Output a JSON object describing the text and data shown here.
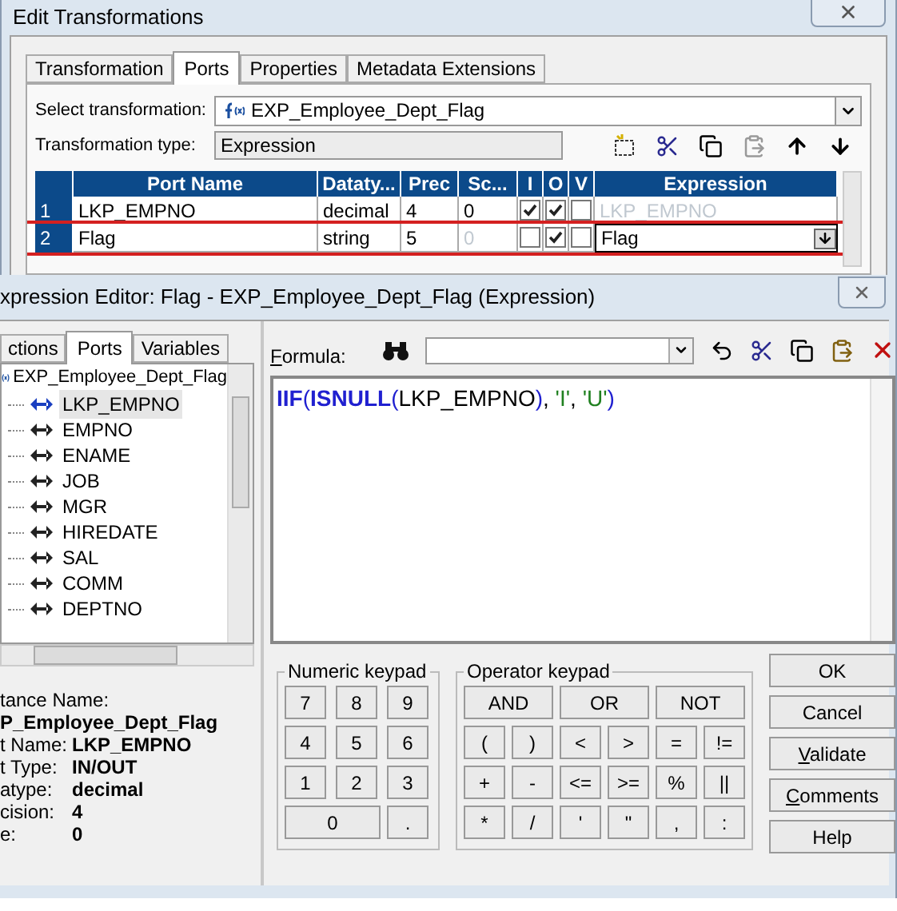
{
  "window": {
    "title": "Edit Transformations"
  },
  "tabs": [
    {
      "label": "Transformation",
      "selected": false
    },
    {
      "label": "Ports",
      "selected": true
    },
    {
      "label": "Properties",
      "selected": false
    },
    {
      "label": "Metadata Extensions",
      "selected": false
    }
  ],
  "select_transformation": {
    "label": "Select transformation:",
    "value": "EXP_Employee_Dept_Flag"
  },
  "transformation_type": {
    "label": "Transformation type:",
    "value": "Expression"
  },
  "ports_table": {
    "columns": [
      "Port Name",
      "Dataty...",
      "Prec",
      "Sc...",
      "I",
      "O",
      "V",
      "Expression"
    ],
    "rows": [
      {
        "number": "1",
        "name": "LKP_EMPNO",
        "datatype": "decimal",
        "prec": "4",
        "scale": "0",
        "scale_disabled": false,
        "input": true,
        "output": true,
        "variable": false,
        "expression": "LKP_EMPNO",
        "kind": "readonly",
        "highlighted": false
      },
      {
        "number": "2",
        "name": "Flag",
        "datatype": "string",
        "prec": "5",
        "scale": "0",
        "scale_disabled": true,
        "input": false,
        "output": true,
        "variable": false,
        "expression": "Flag",
        "kind": "editing",
        "highlighted": true
      }
    ]
  },
  "editor": {
    "title": "xpression Editor: Flag - EXP_Employee_Dept_Flag (Expression)",
    "tabs": [
      {
        "label": "ctions",
        "selected": false
      },
      {
        "label": "Ports",
        "selected": true
      },
      {
        "label": "Variables",
        "selected": false
      }
    ],
    "tree": {
      "label": "EXP_Employee_Dept_Flag",
      "children": [
        {
          "label": "LKP_EMPNO",
          "selected": true
        },
        {
          "label": "EMPNO",
          "selected": false
        },
        {
          "label": "ENAME",
          "selected": false
        },
        {
          "label": "JOB",
          "selected": false
        },
        {
          "label": "MGR",
          "selected": false
        },
        {
          "label": "HIREDATE",
          "selected": false
        },
        {
          "label": "SAL",
          "selected": false
        },
        {
          "label": "COMM",
          "selected": false
        },
        {
          "label": "DEPTNO",
          "selected": false
        }
      ]
    },
    "info": {
      "instance_label": "tance Name:",
      "instance_value": "P_Employee_Dept_Flag",
      "fields": [
        {
          "label": "t Name:",
          "value": "LKP_EMPNO"
        },
        {
          "label": "t Type:",
          "value": "IN/OUT"
        },
        {
          "label": "atype:",
          "value": "decimal"
        },
        {
          "label": "cision:",
          "value": "4"
        },
        {
          "label": "e:",
          "value": "0"
        }
      ]
    },
    "formula_label": "Formula:",
    "formula": [
      {
        "kind": "function",
        "text": "IIF"
      },
      {
        "kind": "paren",
        "text": "("
      },
      {
        "kind": "function",
        "text": "ISNULL"
      },
      {
        "kind": "paren",
        "text": "("
      },
      {
        "kind": "plain",
        "text": "LKP_EMPNO"
      },
      {
        "kind": "paren",
        "text": ")"
      },
      {
        "kind": "plain",
        "text": ", "
      },
      {
        "kind": "string",
        "text": "'I'"
      },
      {
        "kind": "plain",
        "text": ", "
      },
      {
        "kind": "string",
        "text": "'U'"
      },
      {
        "kind": "paren",
        "text": ")"
      }
    ],
    "numeric_keypad": {
      "title": "Numeric keypad",
      "keys": [
        {
          "label": "7",
          "kind": "normal"
        },
        {
          "label": "8",
          "kind": "normal"
        },
        {
          "label": "9",
          "kind": "normal"
        },
        {
          "label": "4",
          "kind": "normal"
        },
        {
          "label": "5",
          "kind": "normal"
        },
        {
          "label": "6",
          "kind": "normal"
        },
        {
          "label": "1",
          "kind": "normal"
        },
        {
          "label": "2",
          "kind": "normal"
        },
        {
          "label": "3",
          "kind": "normal"
        },
        {
          "label": "0",
          "kind": "wide"
        },
        {
          "label": ".",
          "kind": "normal"
        }
      ]
    },
    "operator_keypad": {
      "title": "Operator keypad",
      "keys": [
        {
          "label": "AND",
          "kind": "wide"
        },
        {
          "label": "OR",
          "kind": "wide"
        },
        {
          "label": "NOT",
          "kind": "wide"
        },
        {
          "label": "(",
          "kind": "normal"
        },
        {
          "label": ")",
          "kind": "normal"
        },
        {
          "label": "<",
          "kind": "normal"
        },
        {
          "label": ">",
          "kind": "normal"
        },
        {
          "label": "=",
          "kind": "normal"
        },
        {
          "label": "!=",
          "kind": "normal"
        },
        {
          "label": "+",
          "kind": "normal"
        },
        {
          "label": "-",
          "kind": "normal"
        },
        {
          "label": "<=",
          "kind": "normal"
        },
        {
          "label": ">=",
          "kind": "normal"
        },
        {
          "label": "%",
          "kind": "normal"
        },
        {
          "label": "||",
          "kind": "normal"
        },
        {
          "label": "*",
          "kind": "normal"
        },
        {
          "label": "/",
          "kind": "normal"
        },
        {
          "label": "'",
          "kind": "normal"
        },
        {
          "label": "\"",
          "kind": "normal"
        },
        {
          "label": ",",
          "kind": "normal"
        },
        {
          "label": ":",
          "kind": "normal"
        }
      ]
    },
    "buttons": [
      {
        "label": "OK",
        "underline": false
      },
      {
        "label": "Cancel",
        "underline": false
      },
      {
        "label": "Validate",
        "underline": true
      },
      {
        "label": "Comments",
        "underline": true
      },
      {
        "label": "Help",
        "underline": false
      }
    ]
  }
}
